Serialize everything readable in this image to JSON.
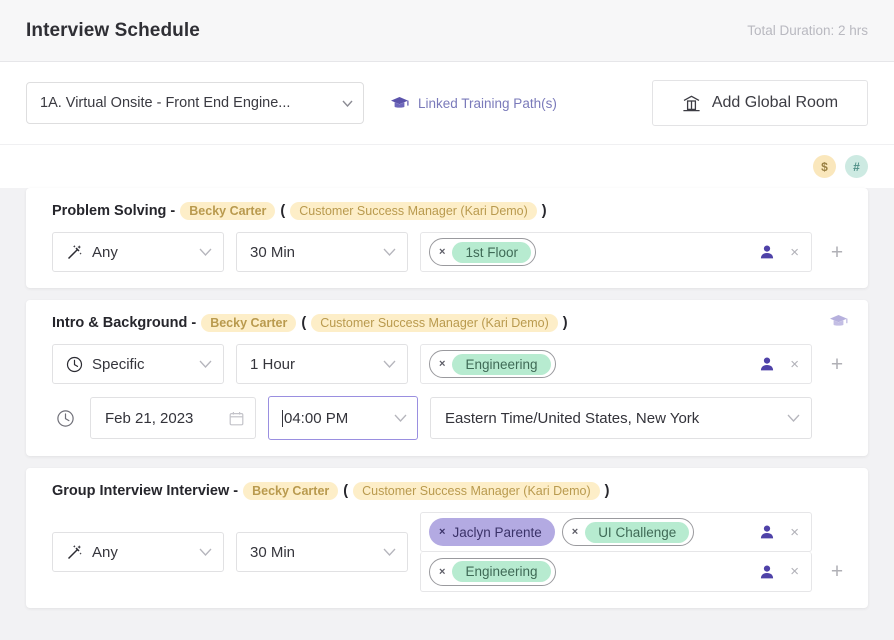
{
  "header": {
    "title": "Interview Schedule",
    "total_duration": "Total Duration: 2 hrs"
  },
  "toolbar": {
    "schedule_select_value": "1A. Virtual Onsite - Front End Engine...",
    "training_link_label": "Linked Training Path(s)",
    "training_icon": "graduation-cap-icon",
    "add_room_label": "Add Global Room",
    "add_room_icon": "building-icon"
  },
  "badges": [
    {
      "name": "money-badge",
      "label": "$",
      "color": "#fae7bc"
    },
    {
      "name": "hash-badge",
      "label": "#",
      "color": "#cdeae2"
    }
  ],
  "interviews": [
    {
      "title": "Problem Solving -",
      "person": "Becky Carter",
      "role": "Customer Success Manager (Kari Demo)",
      "paren_open": "(",
      "paren_close": ")",
      "type_value": "Any",
      "type_icon": "magic-wand-icon",
      "duration_value": "30 Min",
      "rooms": [
        {
          "chips": [
            {
              "style": "outline",
              "label": "1st Floor",
              "remove": "×"
            }
          ]
        }
      ],
      "has_grad_icon": false,
      "has_schedule_row": false
    },
    {
      "title": "Intro & Background -",
      "person": "Becky Carter",
      "role": "Customer Success Manager (Kari Demo)",
      "paren_open": "(",
      "paren_close": ")",
      "type_value": "Specific",
      "type_icon": "clock-icon",
      "duration_value": "1 Hour",
      "rooms": [
        {
          "chips": [
            {
              "style": "outline",
              "label": "Engineering",
              "remove": "×"
            }
          ]
        }
      ],
      "has_grad_icon": true,
      "has_schedule_row": true,
      "schedule": {
        "lead_icon": "clock-icon",
        "date_value": "Feb 21, 2023",
        "date_icon": "calendar-icon",
        "time_value": "04:00 PM",
        "timezone_value": "Eastern Time/United States, New York"
      }
    },
    {
      "title": "Group Interview Interview -",
      "person": "Becky Carter",
      "role": "Customer Success Manager (Kari Demo)",
      "paren_open": "(",
      "paren_close": ")",
      "type_value": "Any",
      "type_icon": "magic-wand-icon",
      "duration_value": "30 Min",
      "rooms": [
        {
          "chips": [
            {
              "style": "solid",
              "label": "Jaclyn Parente",
              "remove": "×"
            },
            {
              "style": "outline",
              "label": "UI Challenge",
              "remove": "×"
            }
          ]
        },
        {
          "chips": [
            {
              "style": "outline",
              "label": "Engineering",
              "remove": "×"
            }
          ]
        }
      ],
      "has_grad_icon": false,
      "has_schedule_row": false
    }
  ],
  "icons": {
    "person": "person-icon",
    "close": "×",
    "add": "+",
    "caret": "⌄"
  }
}
